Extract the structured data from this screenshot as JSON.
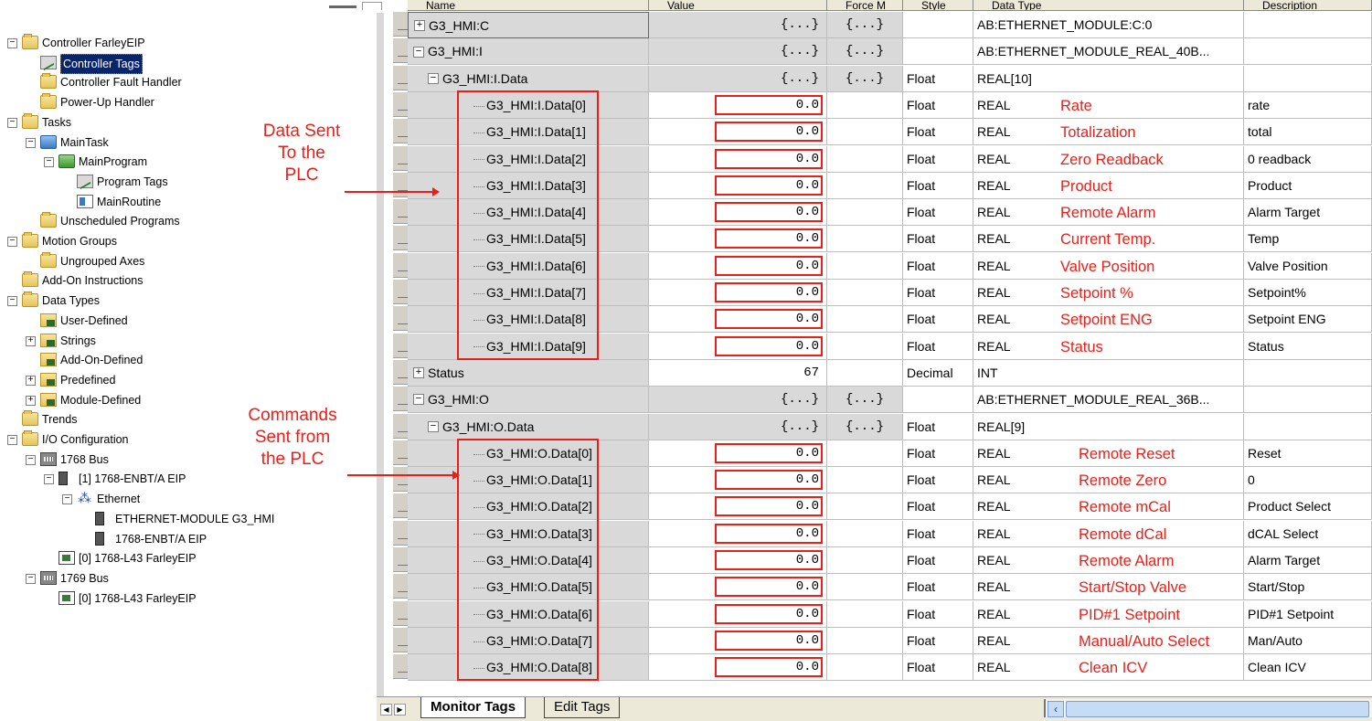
{
  "tree": [
    {
      "label": "Controller FarleyEIP",
      "icon": "folder",
      "indent": 0,
      "expander": "−"
    },
    {
      "label": "Controller Tags",
      "icon": "tag",
      "indent": 1,
      "selected": true
    },
    {
      "label": "Controller Fault Handler",
      "icon": "folder",
      "indent": 1
    },
    {
      "label": "Power-Up Handler",
      "icon": "folder",
      "indent": 1
    },
    {
      "label": "Tasks",
      "icon": "folder",
      "indent": 0,
      "expander": "−"
    },
    {
      "label": "MainTask",
      "icon": "task",
      "indent": 1,
      "expander": "−"
    },
    {
      "label": "MainProgram",
      "icon": "program",
      "indent": 2,
      "expander": "−"
    },
    {
      "label": "Program Tags",
      "icon": "tag",
      "indent": 3
    },
    {
      "label": "MainRoutine",
      "icon": "routine",
      "indent": 3
    },
    {
      "label": "Unscheduled Programs",
      "icon": "folder",
      "indent": 1
    },
    {
      "label": "Motion Groups",
      "icon": "folder",
      "indent": 0,
      "expander": "−"
    },
    {
      "label": "Ungrouped Axes",
      "icon": "folder",
      "indent": 1
    },
    {
      "label": "Add-On Instructions",
      "icon": "folder",
      "indent": 0
    },
    {
      "label": "Data Types",
      "icon": "folder",
      "indent": 0,
      "expander": "−"
    },
    {
      "label": "User-Defined",
      "icon": "type",
      "indent": 1
    },
    {
      "label": "Strings",
      "icon": "type",
      "indent": 1,
      "expander": "+"
    },
    {
      "label": "Add-On-Defined",
      "icon": "type",
      "indent": 1
    },
    {
      "label": "Predefined",
      "icon": "type",
      "indent": 1,
      "expander": "+"
    },
    {
      "label": "Module-Defined",
      "icon": "type",
      "indent": 1,
      "expander": "+"
    },
    {
      "label": "Trends",
      "icon": "folder",
      "indent": 0
    },
    {
      "label": "I/O Configuration",
      "icon": "folder",
      "indent": 0,
      "expander": "−"
    },
    {
      "label": "1768 Bus",
      "icon": "bus",
      "indent": 1,
      "expander": "−"
    },
    {
      "label": "[1] 1768-ENBT/A EIP",
      "icon": "module",
      "indent": 2,
      "expander": "−"
    },
    {
      "label": "Ethernet",
      "icon": "network",
      "indent": 3,
      "expander": "−"
    },
    {
      "label": "ETHERNET-MODULE G3_HMI",
      "icon": "module",
      "indent": 4
    },
    {
      "label": "1768-ENBT/A EIP",
      "icon": "module",
      "indent": 4
    },
    {
      "label": "[0] 1768-L43 FarleyEIP",
      "icon": "cpu",
      "indent": 2
    },
    {
      "label": "1769 Bus",
      "icon": "bus",
      "indent": 1,
      "expander": "−"
    },
    {
      "label": "[0] 1768-L43 FarleyEIP",
      "icon": "cpu",
      "indent": 2
    }
  ],
  "annotations": {
    "sent_to": [
      "Data Sent",
      "To the",
      "PLC"
    ],
    "sent_from": [
      "Commands",
      "Sent from",
      "the PLC"
    ]
  },
  "columns": [
    "Name",
    "Value",
    "Force M",
    "Style",
    "Data Type",
    "Description"
  ],
  "rows": [
    {
      "name": "G3_HMI:C",
      "exp": "+",
      "level": 0,
      "value": "{...}",
      "force": "{...}",
      "style": "",
      "type": "AB:ETHERNET_MODULE:C:0",
      "desc": "",
      "label": "",
      "nameBox": true
    },
    {
      "name": "G3_HMI:I",
      "exp": "−",
      "level": 0,
      "value": "{...}",
      "force": "{...}",
      "style": "",
      "type": "AB:ETHERNET_MODULE_REAL_40B...",
      "desc": "",
      "label": ""
    },
    {
      "name": "G3_HMI:I.Data",
      "exp": "−",
      "level": 1,
      "value": "{...}",
      "force": "{...}",
      "style": "Float",
      "type": "REAL[10]",
      "desc": "",
      "label": ""
    },
    {
      "name": "G3_HMI:I.Data[0]",
      "level": 2,
      "value": "0.0",
      "force": "",
      "style": "Float",
      "type": "REAL",
      "desc": "rate",
      "label": "Rate",
      "leaf": true
    },
    {
      "name": "G3_HMI:I.Data[1]",
      "level": 2,
      "value": "0.0",
      "force": "",
      "style": "Float",
      "type": "REAL",
      "desc": "total",
      "label": "Totalization",
      "leaf": true
    },
    {
      "name": "G3_HMI:I.Data[2]",
      "level": 2,
      "value": "0.0",
      "force": "",
      "style": "Float",
      "type": "REAL",
      "desc": "0 readback",
      "label": "Zero Readback",
      "leaf": true
    },
    {
      "name": "G3_HMI:I.Data[3]",
      "level": 2,
      "value": "0.0",
      "force": "",
      "style": "Float",
      "type": "REAL",
      "desc": "Product",
      "label": "Product",
      "leaf": true
    },
    {
      "name": "G3_HMI:I.Data[4]",
      "level": 2,
      "value": "0.0",
      "force": "",
      "style": "Float",
      "type": "REAL",
      "desc": "Alarm Target",
      "label": "Remote Alarm",
      "leaf": true
    },
    {
      "name": "G3_HMI:I.Data[5]",
      "level": 2,
      "value": "0.0",
      "force": "",
      "style": "Float",
      "type": "REAL",
      "desc": "Temp",
      "label": "Current Temp.",
      "leaf": true
    },
    {
      "name": "G3_HMI:I.Data[6]",
      "level": 2,
      "value": "0.0",
      "force": "",
      "style": "Float",
      "type": "REAL",
      "desc": "Valve Position",
      "label": "Valve Position",
      "leaf": true
    },
    {
      "name": "G3_HMI:I.Data[7]",
      "level": 2,
      "value": "0.0",
      "force": "",
      "style": "Float",
      "type": "REAL",
      "desc": "Setpoint%",
      "label": "Setpoint %",
      "leaf": true
    },
    {
      "name": "G3_HMI:I.Data[8]",
      "level": 2,
      "value": "0.0",
      "force": "",
      "style": "Float",
      "type": "REAL",
      "desc": "Setpoint ENG",
      "label": "Setpoint ENG",
      "leaf": true
    },
    {
      "name": "G3_HMI:I.Data[9]",
      "level": 2,
      "value": "0.0",
      "force": "",
      "style": "Float",
      "type": "REAL",
      "desc": "Status",
      "label": "Status",
      "leaf": true
    },
    {
      "name": "Status",
      "exp": "+",
      "level": 0,
      "value": "67",
      "force": "",
      "style": "Decimal",
      "type": "INT",
      "desc": "",
      "label": "",
      "plain": true
    },
    {
      "name": "G3_HMI:O",
      "exp": "−",
      "level": 0,
      "value": "{...}",
      "force": "{...}",
      "style": "",
      "type": "AB:ETHERNET_MODULE_REAL_36B...",
      "desc": "",
      "label": ""
    },
    {
      "name": "G3_HMI:O.Data",
      "exp": "−",
      "level": 1,
      "value": "{...}",
      "force": "{...}",
      "style": "Float",
      "type": "REAL[9]",
      "desc": "",
      "label": ""
    },
    {
      "name": "G3_HMI:O.Data[0]",
      "level": 2,
      "value": "0.0",
      "force": "",
      "style": "Float",
      "type": "REAL",
      "desc": "Reset",
      "label": "Remote Reset",
      "leaf": true
    },
    {
      "name": "G3_HMI:O.Data[1]",
      "level": 2,
      "value": "0.0",
      "force": "",
      "style": "Float",
      "type": "REAL",
      "desc": "0",
      "label": "Remote Zero",
      "leaf": true
    },
    {
      "name": "G3_HMI:O.Data[2]",
      "level": 2,
      "value": "0.0",
      "force": "",
      "style": "Float",
      "type": "REAL",
      "desc": "Product Select",
      "label": "Remote mCal",
      "leaf": true
    },
    {
      "name": "G3_HMI:O.Data[3]",
      "level": 2,
      "value": "0.0",
      "force": "",
      "style": "Float",
      "type": "REAL",
      "desc": "dCAL Select",
      "label": "Remote dCal",
      "leaf": true
    },
    {
      "name": "G3_HMI:O.Data[4]",
      "level": 2,
      "value": "0.0",
      "force": "",
      "style": "Float",
      "type": "REAL",
      "desc": "Alarm Target",
      "label": "Remote Alarm",
      "leaf": true
    },
    {
      "name": "G3_HMI:O.Data[5]",
      "level": 2,
      "value": "0.0",
      "force": "",
      "style": "Float",
      "type": "REAL",
      "desc": "Start/Stop",
      "label": "Start/Stop Valve",
      "leaf": true
    },
    {
      "name": "G3_HMI:O.Data[6]",
      "level": 2,
      "value": "0.0",
      "force": "",
      "style": "Float",
      "type": "REAL",
      "desc": "PID#1 Setpoint",
      "label": "PID#1 Setpoint",
      "leaf": true
    },
    {
      "name": "G3_HMI:O.Data[7]",
      "level": 2,
      "value": "0.0",
      "force": "",
      "style": "Float",
      "type": "REAL",
      "desc": "Man/Auto",
      "label": "Manual/Auto Select",
      "leaf": true
    },
    {
      "name": "G3_HMI:O.Data[8]",
      "level": 2,
      "value": "0.0",
      "force": "",
      "style": "Float",
      "type": "REAL",
      "desc": "Clean ICV",
      "label": "Clean ICV",
      "leaf": true
    }
  ],
  "tabs": {
    "monitor": "Monitor Tags",
    "edit": "Edit Tags"
  },
  "colors": {
    "annotation": "#e8201a",
    "grid_grey": "#d9d9d9",
    "selection": "#0a246a"
  }
}
